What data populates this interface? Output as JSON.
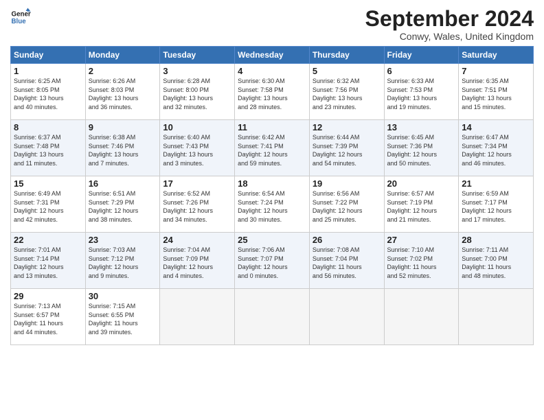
{
  "logo": {
    "line1": "General",
    "line2": "Blue"
  },
  "title": "September 2024",
  "subtitle": "Conwy, Wales, United Kingdom",
  "days_header": [
    "Sunday",
    "Monday",
    "Tuesday",
    "Wednesday",
    "Thursday",
    "Friday",
    "Saturday"
  ],
  "weeks": [
    [
      {
        "num": "1",
        "info": "Sunrise: 6:25 AM\nSunset: 8:05 PM\nDaylight: 13 hours\nand 40 minutes."
      },
      {
        "num": "2",
        "info": "Sunrise: 6:26 AM\nSunset: 8:03 PM\nDaylight: 13 hours\nand 36 minutes."
      },
      {
        "num": "3",
        "info": "Sunrise: 6:28 AM\nSunset: 8:00 PM\nDaylight: 13 hours\nand 32 minutes."
      },
      {
        "num": "4",
        "info": "Sunrise: 6:30 AM\nSunset: 7:58 PM\nDaylight: 13 hours\nand 28 minutes."
      },
      {
        "num": "5",
        "info": "Sunrise: 6:32 AM\nSunset: 7:56 PM\nDaylight: 13 hours\nand 23 minutes."
      },
      {
        "num": "6",
        "info": "Sunrise: 6:33 AM\nSunset: 7:53 PM\nDaylight: 13 hours\nand 19 minutes."
      },
      {
        "num": "7",
        "info": "Sunrise: 6:35 AM\nSunset: 7:51 PM\nDaylight: 13 hours\nand 15 minutes."
      }
    ],
    [
      {
        "num": "8",
        "info": "Sunrise: 6:37 AM\nSunset: 7:48 PM\nDaylight: 13 hours\nand 11 minutes."
      },
      {
        "num": "9",
        "info": "Sunrise: 6:38 AM\nSunset: 7:46 PM\nDaylight: 13 hours\nand 7 minutes."
      },
      {
        "num": "10",
        "info": "Sunrise: 6:40 AM\nSunset: 7:43 PM\nDaylight: 13 hours\nand 3 minutes."
      },
      {
        "num": "11",
        "info": "Sunrise: 6:42 AM\nSunset: 7:41 PM\nDaylight: 12 hours\nand 59 minutes."
      },
      {
        "num": "12",
        "info": "Sunrise: 6:44 AM\nSunset: 7:39 PM\nDaylight: 12 hours\nand 54 minutes."
      },
      {
        "num": "13",
        "info": "Sunrise: 6:45 AM\nSunset: 7:36 PM\nDaylight: 12 hours\nand 50 minutes."
      },
      {
        "num": "14",
        "info": "Sunrise: 6:47 AM\nSunset: 7:34 PM\nDaylight: 12 hours\nand 46 minutes."
      }
    ],
    [
      {
        "num": "15",
        "info": "Sunrise: 6:49 AM\nSunset: 7:31 PM\nDaylight: 12 hours\nand 42 minutes."
      },
      {
        "num": "16",
        "info": "Sunrise: 6:51 AM\nSunset: 7:29 PM\nDaylight: 12 hours\nand 38 minutes."
      },
      {
        "num": "17",
        "info": "Sunrise: 6:52 AM\nSunset: 7:26 PM\nDaylight: 12 hours\nand 34 minutes."
      },
      {
        "num": "18",
        "info": "Sunrise: 6:54 AM\nSunset: 7:24 PM\nDaylight: 12 hours\nand 30 minutes."
      },
      {
        "num": "19",
        "info": "Sunrise: 6:56 AM\nSunset: 7:22 PM\nDaylight: 12 hours\nand 25 minutes."
      },
      {
        "num": "20",
        "info": "Sunrise: 6:57 AM\nSunset: 7:19 PM\nDaylight: 12 hours\nand 21 minutes."
      },
      {
        "num": "21",
        "info": "Sunrise: 6:59 AM\nSunset: 7:17 PM\nDaylight: 12 hours\nand 17 minutes."
      }
    ],
    [
      {
        "num": "22",
        "info": "Sunrise: 7:01 AM\nSunset: 7:14 PM\nDaylight: 12 hours\nand 13 minutes."
      },
      {
        "num": "23",
        "info": "Sunrise: 7:03 AM\nSunset: 7:12 PM\nDaylight: 12 hours\nand 9 minutes."
      },
      {
        "num": "24",
        "info": "Sunrise: 7:04 AM\nSunset: 7:09 PM\nDaylight: 12 hours\nand 4 minutes."
      },
      {
        "num": "25",
        "info": "Sunrise: 7:06 AM\nSunset: 7:07 PM\nDaylight: 12 hours\nand 0 minutes."
      },
      {
        "num": "26",
        "info": "Sunrise: 7:08 AM\nSunset: 7:04 PM\nDaylight: 11 hours\nand 56 minutes."
      },
      {
        "num": "27",
        "info": "Sunrise: 7:10 AM\nSunset: 7:02 PM\nDaylight: 11 hours\nand 52 minutes."
      },
      {
        "num": "28",
        "info": "Sunrise: 7:11 AM\nSunset: 7:00 PM\nDaylight: 11 hours\nand 48 minutes."
      }
    ],
    [
      {
        "num": "29",
        "info": "Sunrise: 7:13 AM\nSunset: 6:57 PM\nDaylight: 11 hours\nand 44 minutes."
      },
      {
        "num": "30",
        "info": "Sunrise: 7:15 AM\nSunset: 6:55 PM\nDaylight: 11 hours\nand 39 minutes."
      },
      {
        "num": "",
        "info": ""
      },
      {
        "num": "",
        "info": ""
      },
      {
        "num": "",
        "info": ""
      },
      {
        "num": "",
        "info": ""
      },
      {
        "num": "",
        "info": ""
      }
    ]
  ]
}
